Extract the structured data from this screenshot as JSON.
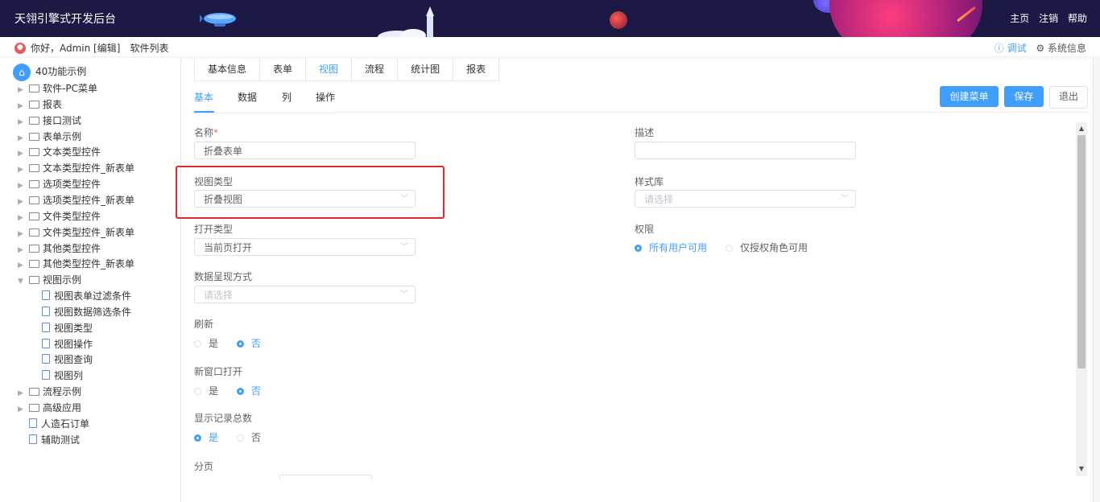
{
  "header": {
    "title": "天翎引擎式开发后台",
    "nav": [
      "主页",
      "注销",
      "帮助"
    ]
  },
  "subbar": {
    "greeting": "你好，Admin [编辑]",
    "software_list": "软件列表",
    "debug": "ⓘ 调试",
    "system_info": "⚙ 系统信息"
  },
  "tree": {
    "root": "40功能示例",
    "items": [
      {
        "label": "软件-PC菜单",
        "type": "folder",
        "level": 0
      },
      {
        "label": "报表",
        "type": "folder",
        "level": 0
      },
      {
        "label": "接口测试",
        "type": "folder",
        "level": 0
      },
      {
        "label": "表单示例",
        "type": "folder",
        "level": 0
      },
      {
        "label": "文本类型控件",
        "type": "folder",
        "level": 0
      },
      {
        "label": "文本类型控件_新表单",
        "type": "folder",
        "level": 0
      },
      {
        "label": "选项类型控件",
        "type": "folder",
        "level": 0
      },
      {
        "label": "选项类型控件_新表单",
        "type": "folder",
        "level": 0
      },
      {
        "label": "文件类型控件",
        "type": "folder",
        "level": 0
      },
      {
        "label": "文件类型控件_新表单",
        "type": "folder",
        "level": 0
      },
      {
        "label": "其他类型控件",
        "type": "folder",
        "level": 0
      },
      {
        "label": "其他类型控件_新表单",
        "type": "folder",
        "level": 0
      },
      {
        "label": "视图示例",
        "type": "folder-open",
        "level": 0
      },
      {
        "label": "视图表单过滤条件",
        "type": "doc",
        "level": 1
      },
      {
        "label": "视图数据筛选条件",
        "type": "doc",
        "level": 1
      },
      {
        "label": "视图类型",
        "type": "doc",
        "level": 1
      },
      {
        "label": "视图操作",
        "type": "doc",
        "level": 1
      },
      {
        "label": "视图查询",
        "type": "doc",
        "level": 1
      },
      {
        "label": "视图列",
        "type": "doc",
        "level": 1
      },
      {
        "label": "流程示例",
        "type": "folder",
        "level": 0
      },
      {
        "label": "高级应用",
        "type": "folder",
        "level": 0
      },
      {
        "label": "人造石订单",
        "type": "doc",
        "level": 0
      },
      {
        "label": "辅助测试",
        "type": "doc",
        "level": 0
      }
    ]
  },
  "tabs": [
    "基本信息",
    "表单",
    "视图",
    "流程",
    "统计图",
    "报表"
  ],
  "active_tab": "视图",
  "subtabs": [
    "基本",
    "数据",
    "列",
    "操作"
  ],
  "buttons": {
    "create_menu": "创建菜单",
    "save": "保存",
    "exit": "退出"
  },
  "form": {
    "name_label": "名称",
    "name_required": "*",
    "name_value": "折叠表单",
    "desc_label": "描述",
    "desc_value": "",
    "view_type_label": "视图类型",
    "view_type_value": "折叠视图",
    "style_label": "样式库",
    "style_placeholder": "请选择",
    "open_type_label": "打开类型",
    "open_type_value": "当前页打开",
    "perm_label": "权限",
    "perm_options": [
      "所有用户可用",
      "仅授权角色可用"
    ],
    "display_label": "数据呈现方式",
    "display_placeholder": "请选择",
    "refresh_label": "刷新",
    "new_window_label": "新窗口打开",
    "show_count_label": "显示记录总数",
    "yes": "是",
    "no": "否",
    "paging_label": "分页"
  },
  "colors": {
    "accent": "#409eff",
    "header_bg": "#1c1a45",
    "highlight": "#e0292f"
  }
}
